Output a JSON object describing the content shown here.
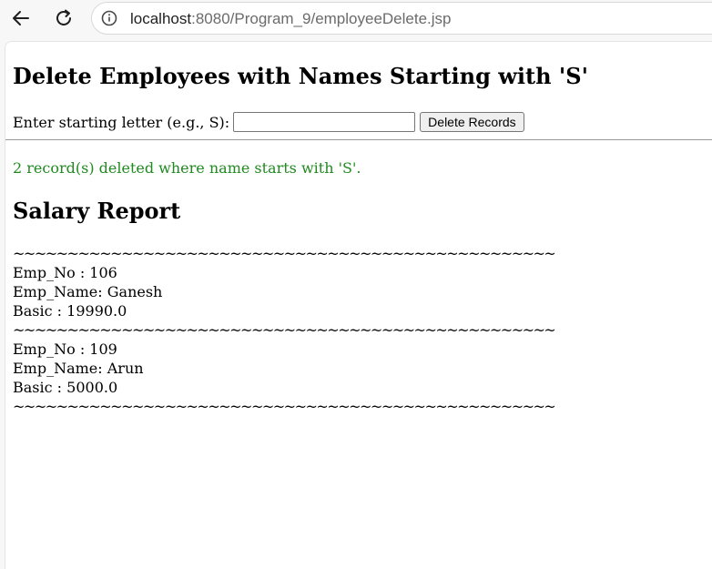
{
  "browser": {
    "back_icon": "back-arrow-icon",
    "reload_icon": "reload-icon",
    "site_info_icon": "site-info-icon",
    "url_host": "localhost",
    "url_path": ":8080/Program_9/employeeDelete.jsp"
  },
  "page": {
    "title": "Delete Employees with Names Starting with 'S'",
    "form": {
      "label": "Enter starting letter (e.g., S):",
      "input_value": "",
      "button_label": "Delete Records"
    },
    "status_message": "2 record(s) deleted where name starts with 'S'.",
    "status_color": "#1f8a1f",
    "report_heading": "Salary Report",
    "separator": "~~~~~~~~~~~~~~~~~~~~~~~~~~~~~~~~~~~~~~~~~~~~~~~~~~~~~~~~~~~~~~~~~~~~~~~~~~~~~~~~~~",
    "records": [
      {
        "emp_no": "Emp_No : 106",
        "emp_name": "Emp_Name: Ganesh",
        "basic": "Basic : 19990.0"
      },
      {
        "emp_no": "Emp_No : 109",
        "emp_name": "Emp_Name: Arun",
        "basic": "Basic : 5000.0"
      }
    ]
  }
}
